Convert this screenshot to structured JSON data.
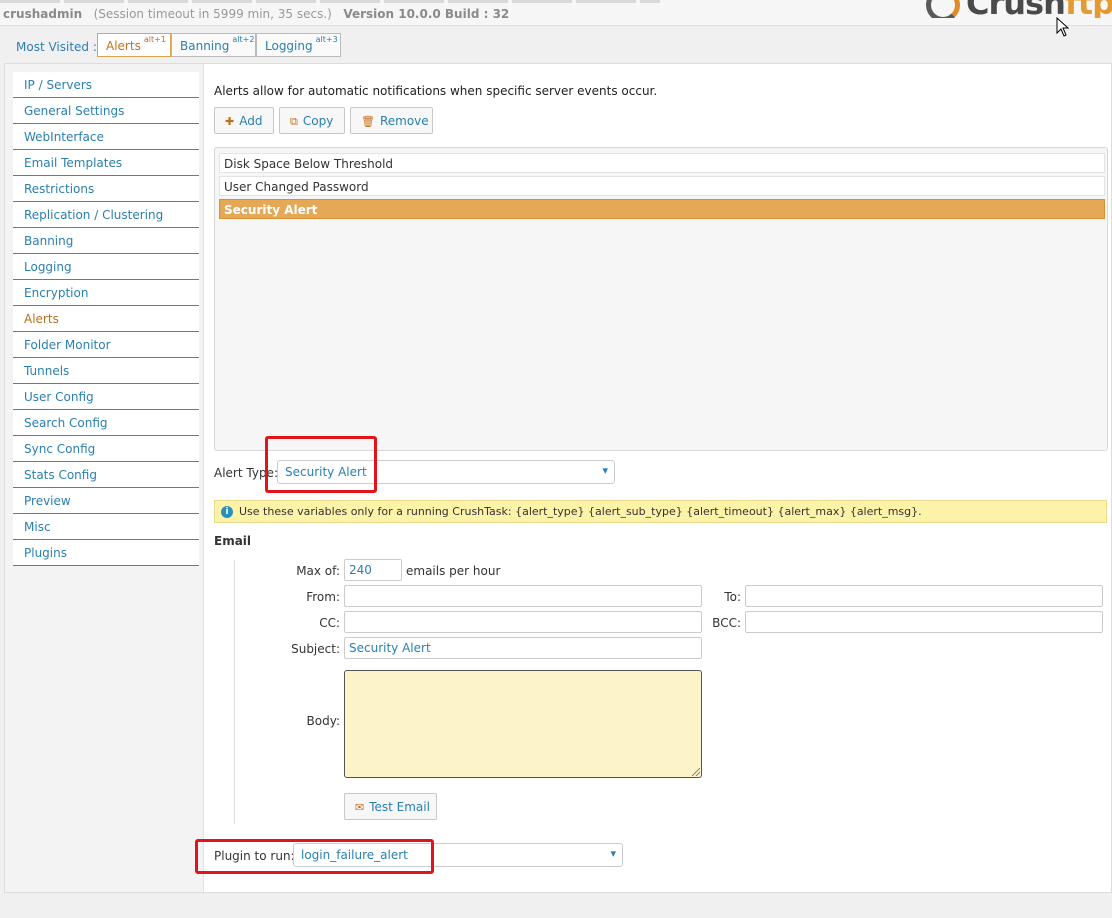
{
  "header": {
    "username": "crushadmin",
    "session_text": "(Session timeout in 5999 min, 35 secs.)",
    "version_text": "Version 10.0.0 Build : 32",
    "logo_text_main": "Crush",
    "logo_text_accent": "ftp"
  },
  "most_visited": {
    "label": "Most Visited :",
    "tabs": [
      {
        "label": "Alerts",
        "shortcut": "alt+1"
      },
      {
        "label": "Banning",
        "shortcut": "alt+2"
      },
      {
        "label": "Logging",
        "shortcut": "alt+3"
      }
    ]
  },
  "sidebar": {
    "items": [
      {
        "label": "IP / Servers"
      },
      {
        "label": "General Settings"
      },
      {
        "label": "WebInterface"
      },
      {
        "label": "Email Templates"
      },
      {
        "label": "Restrictions"
      },
      {
        "label": "Replication / Clustering"
      },
      {
        "label": "Banning"
      },
      {
        "label": "Logging"
      },
      {
        "label": "Encryption"
      },
      {
        "label": "Alerts"
      },
      {
        "label": "Folder Monitor"
      },
      {
        "label": "Tunnels"
      },
      {
        "label": "User Config"
      },
      {
        "label": "Search Config"
      },
      {
        "label": "Sync Config"
      },
      {
        "label": "Stats Config"
      },
      {
        "label": "Preview"
      },
      {
        "label": "Misc"
      },
      {
        "label": "Plugins"
      }
    ]
  },
  "alerts": {
    "intro": "Alerts allow for automatic notifications when specific server events occur.",
    "buttons": {
      "add": "Add",
      "copy": "Copy",
      "remove": "Remove"
    },
    "list": [
      {
        "label": "Disk Space Below Threshold"
      },
      {
        "label": "User Changed Password"
      },
      {
        "label": "Security Alert"
      }
    ],
    "alert_type_label": "Alert Type:",
    "alert_type_value": "Security Alert",
    "info_text": "Use these variables only for a running CrushTask:  {alert_type} {alert_sub_type} {alert_timeout} {alert_max} {alert_msg}."
  },
  "email": {
    "section_title": "Email",
    "max_label": "Max of:",
    "max_value": "240",
    "max_suffix": "emails per hour",
    "from_label": "From:",
    "from_value": "",
    "to_label": "To:",
    "to_value": "",
    "cc_label": "CC:",
    "cc_value": "",
    "bcc_label": "BCC:",
    "bcc_value": "",
    "subject_label": "Subject:",
    "subject_value": "Security Alert",
    "body_label": "Body:",
    "test_button": "Test Email"
  },
  "plugin": {
    "label": "Plugin to run:",
    "value": "login_failure_alert"
  },
  "colors": {
    "accent": "#2a7fb0",
    "selected": "#e4a857",
    "highlight": "#e0141a"
  }
}
